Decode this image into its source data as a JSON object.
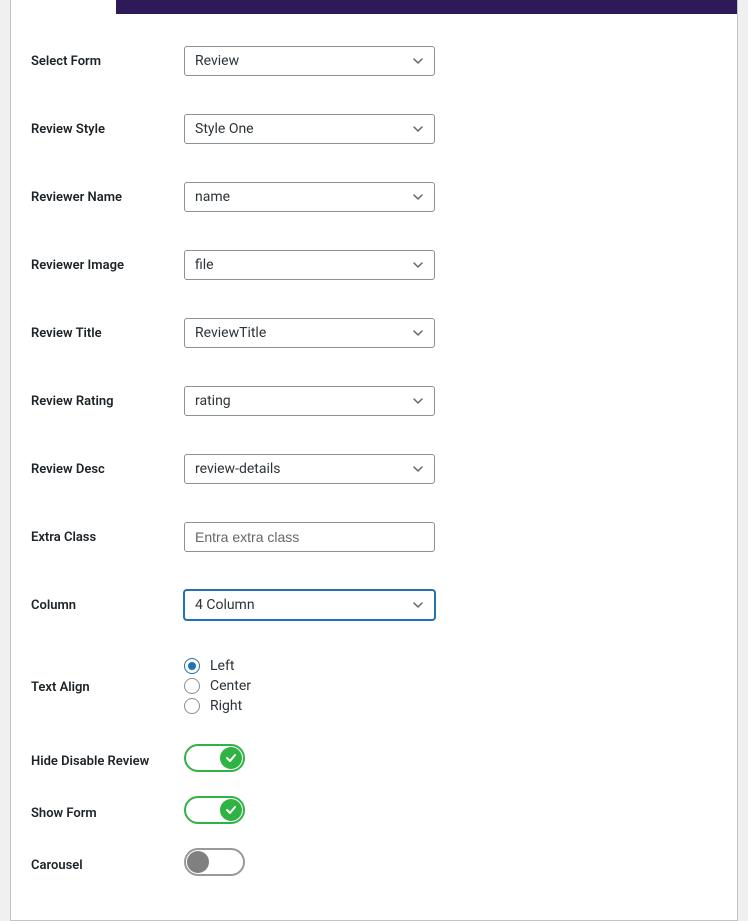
{
  "fields": {
    "selectForm": {
      "label": "Select Form",
      "value": "Review"
    },
    "reviewStyle": {
      "label": "Review Style",
      "value": "Style One"
    },
    "reviewerName": {
      "label": "Reviewer Name",
      "value": "name"
    },
    "reviewerImage": {
      "label": "Reviewer Image",
      "value": "file"
    },
    "reviewTitle": {
      "label": "Review Title",
      "value": "ReviewTitle"
    },
    "reviewRating": {
      "label": "Review Rating",
      "value": "rating"
    },
    "reviewDesc": {
      "label": "Review Desc",
      "value": "review-details"
    },
    "extraClass": {
      "label": "Extra Class",
      "placeholder": "Entra extra class"
    },
    "column": {
      "label": "Column",
      "value": "4 Column"
    },
    "textAlign": {
      "label": "Text Align",
      "options": {
        "left": "Left",
        "center": "Center",
        "right": "Right"
      },
      "selected": "left"
    },
    "hideDisable": {
      "label": "Hide Disable Review",
      "on": true
    },
    "showForm": {
      "label": "Show Form",
      "on": true
    },
    "carousel": {
      "label": "Carousel",
      "on": false
    }
  }
}
